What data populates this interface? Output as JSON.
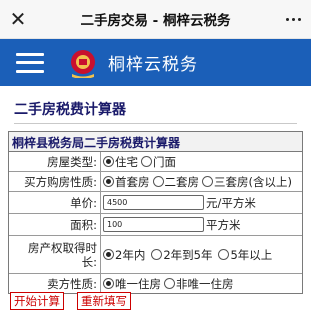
{
  "window": {
    "title": "二手房交易 - 桐梓云税务",
    "close_icon": "close-icon",
    "more_icon": "more-dots-icon"
  },
  "header": {
    "brand": "桐梓云税务",
    "menu_icon": "menu-icon",
    "logo_icon": "tax-emblem-icon",
    "color": "#1b5fb8"
  },
  "section": {
    "title": "二手房税费计算器"
  },
  "calculator": {
    "title": "桐梓县税务局二手房税费计算器",
    "house_type": {
      "label": "房屋类型:",
      "options": [
        "住宅",
        "门面"
      ],
      "selected": "住宅"
    },
    "buyer_status": {
      "label": "买方购房性质:",
      "options": [
        "首套房",
        "二套房",
        "三套房(含以上)"
      ],
      "selected": "首套房"
    },
    "unit_price": {
      "label": "单价:",
      "value": "4500",
      "unit": "元/平方米"
    },
    "area": {
      "label": "面积:",
      "value": "100",
      "unit": "平方米"
    },
    "ownership": {
      "label_line1": "房产权取得时",
      "label_line2": "长:",
      "options": [
        "2年内",
        "2年到5年",
        "5年以上"
      ],
      "selected": "2年内"
    },
    "seller_status": {
      "label": "卖方性质:",
      "options": [
        "唯一住房",
        "非唯一住房"
      ],
      "selected": "唯一住房"
    }
  },
  "buttons": {
    "calculate": "开始计算",
    "reset": "重新填写",
    "accent": "#cc0000"
  }
}
